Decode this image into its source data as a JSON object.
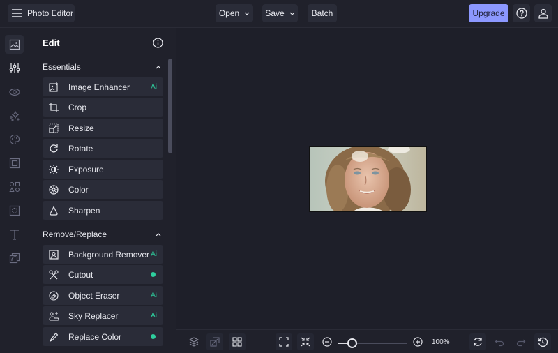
{
  "header": {
    "app_title": "Photo Editor",
    "open_label": "Open",
    "save_label": "Save",
    "batch_label": "Batch",
    "upgrade_label": "Upgrade"
  },
  "rail": {
    "items": [
      {
        "icon": "image-icon",
        "active": true
      },
      {
        "icon": "sliders-icon",
        "active": false
      },
      {
        "icon": "eye-icon",
        "active": false
      },
      {
        "icon": "sparkles-icon",
        "active": false
      },
      {
        "icon": "palette-icon",
        "active": false
      },
      {
        "icon": "frame-icon",
        "active": false
      },
      {
        "icon": "shapes-icon",
        "active": false
      },
      {
        "icon": "texture-icon",
        "active": false
      },
      {
        "icon": "text-icon",
        "active": false
      },
      {
        "icon": "overlay-icon",
        "active": false
      }
    ]
  },
  "panel": {
    "title": "Edit",
    "sections": [
      {
        "title": "Essentials",
        "tools": [
          {
            "label": "Image Enhancer",
            "icon": "image-enhance-icon",
            "badge": "Ai"
          },
          {
            "label": "Crop",
            "icon": "crop-icon",
            "badge": ""
          },
          {
            "label": "Resize",
            "icon": "resize-icon",
            "badge": ""
          },
          {
            "label": "Rotate",
            "icon": "rotate-icon",
            "badge": ""
          },
          {
            "label": "Exposure",
            "icon": "exposure-icon",
            "badge": ""
          },
          {
            "label": "Color",
            "icon": "color-icon",
            "badge": ""
          },
          {
            "label": "Sharpen",
            "icon": "sharpen-icon",
            "badge": ""
          }
        ]
      },
      {
        "title": "Remove/Replace",
        "tools": [
          {
            "label": "Background Remover",
            "icon": "background-remover-icon",
            "badge": "Ai"
          },
          {
            "label": "Cutout",
            "icon": "scissors-icon",
            "badge": "dot"
          },
          {
            "label": "Object Eraser",
            "icon": "eraser-icon",
            "badge": "Ai"
          },
          {
            "label": "Sky Replacer",
            "icon": "sky-icon",
            "badge": "Ai"
          },
          {
            "label": "Replace Color",
            "icon": "eyedropper-icon",
            "badge": "dot"
          }
        ]
      }
    ]
  },
  "bottombar": {
    "zoom_value": "100%",
    "zoom_slider_fraction": 0.2
  },
  "colors": {
    "accent": "#8c98ff",
    "ai_badge": "#2ecf9e",
    "background": "#1e1f29"
  }
}
